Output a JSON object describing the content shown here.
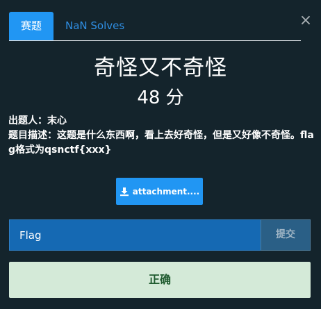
{
  "tabs": {
    "challenge_label": "赛题",
    "solves_label": "NaN Solves"
  },
  "close": {
    "symbol": "×",
    "icon": "close-icon"
  },
  "challenge": {
    "name": "奇怪又不奇怪",
    "value": "48 分",
    "author_line": "出题人：末心",
    "description_line": "题目描述：这题是什么东西啊，看上去好奇怪，但是又好像不奇怪。flag格式为qsnctf{xxx}"
  },
  "attachment": {
    "icon": "download-icon",
    "label": "attachment...."
  },
  "submission": {
    "placeholder": "Flag",
    "submit_label": "提交"
  },
  "result": {
    "message": "正确"
  },
  "colors": {
    "background": "#14242c",
    "primary": "#2196f3",
    "tab_link": "#2f8fe4",
    "input_bg": "#1569b3",
    "submit_bg": "#2a5f86",
    "success_bg": "#d4ead8",
    "success_text": "#1e5a2e"
  }
}
